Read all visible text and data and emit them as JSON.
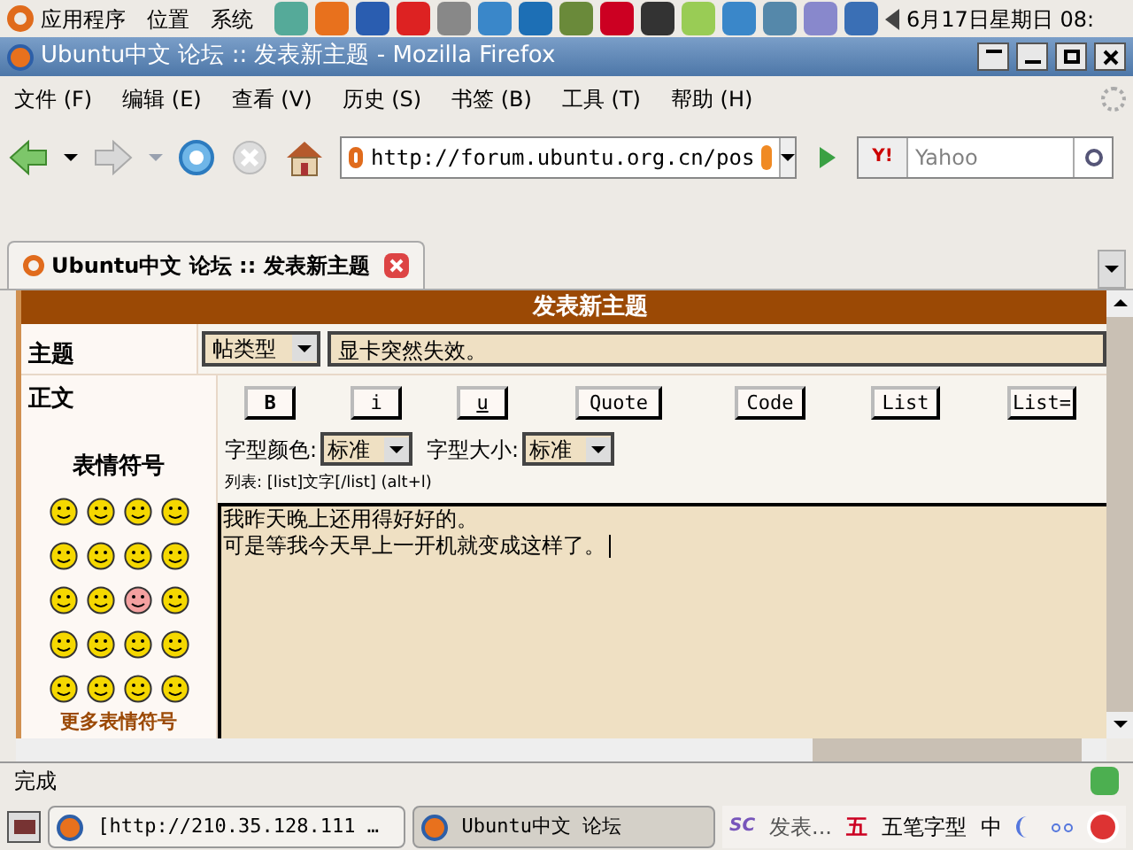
{
  "top_panel": {
    "menus": [
      "应用程序",
      "位置",
      "系统"
    ],
    "clock": "6月17日星期日 08:"
  },
  "window": {
    "title": "Ubuntu中文 论坛 :: 发表新主题 - Mozilla Firefox"
  },
  "menu_bar": [
    "文件 (F)",
    "编辑 (E)",
    "查看 (V)",
    "历史 (S)",
    "书签 (B)",
    "工具 (T)",
    "帮助 (H)"
  ],
  "navigation": {
    "url": "http://forum.ubuntu.org.cn/pos",
    "search_engine_logo": "Y!",
    "search_placeholder": "Yahoo"
  },
  "tabs": [
    {
      "label": "Ubuntu中文 论坛 :: 发表新主题",
      "selected": true
    }
  ],
  "form": {
    "heading": "发表新主题",
    "subject_label": "主题",
    "topic_type": "帖类型",
    "subject": "显卡突然失效。",
    "body_label": "正文",
    "smileys_title": "表情符号",
    "more_smileys": "更多表情符号",
    "format_buttons": [
      "B",
      "i",
      "u",
      "Quote",
      "Code",
      "List",
      "List="
    ],
    "font_color_label": "字型颜色:",
    "font_color": "标准",
    "font_size_label": "字型大小:",
    "font_size": "标准",
    "hint": "列表: [list]文字[/list] (alt+l)",
    "body_lines": [
      "我昨天晚上还用得好好的。",
      "可是等我今天早上一开机就变成这样了。"
    ]
  },
  "status_bar": "完成",
  "taskbar": {
    "items": [
      {
        "label": "[http://210.35.128.111 …",
        "selected": false
      },
      {
        "label": "Ubuntu中文 论坛",
        "selected": true
      }
    ],
    "ime": {
      "logo": "SC",
      "wubi": "五",
      "text": "发表...",
      "mode": "五笔字型",
      "lang": "中"
    }
  }
}
